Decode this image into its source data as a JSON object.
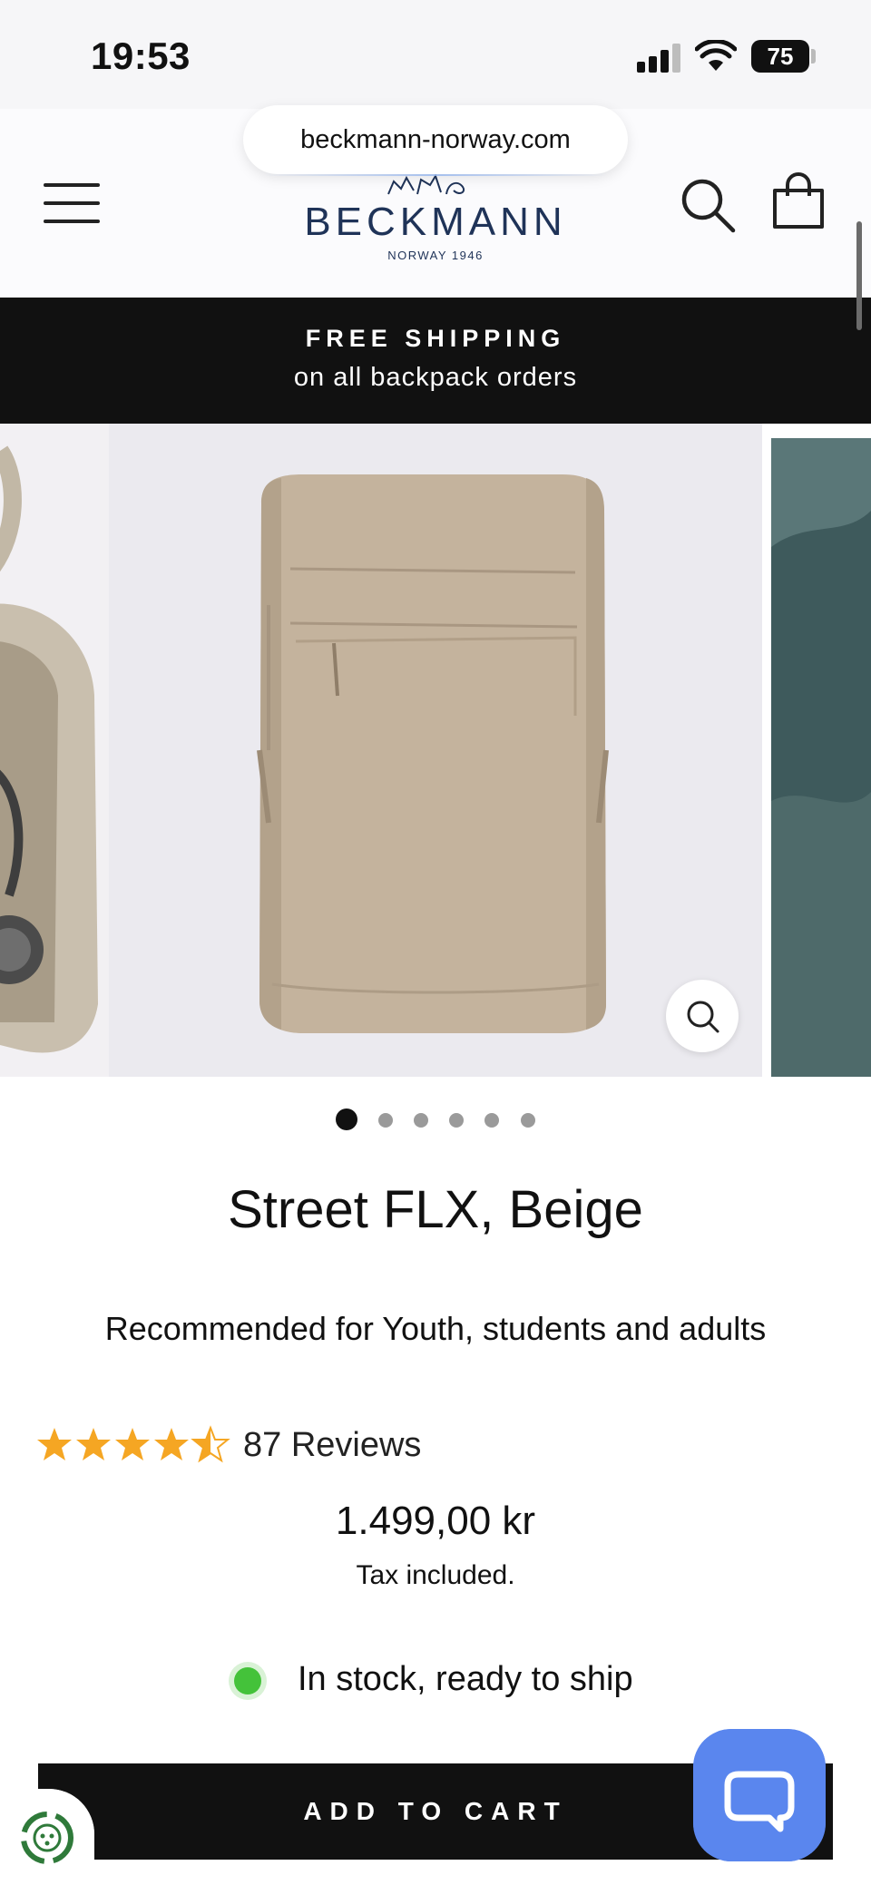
{
  "status_bar": {
    "time": "19:53",
    "battery": "75"
  },
  "browser": {
    "url": "beckmann-norway.com"
  },
  "header": {
    "logo_text": "BECKMANN",
    "logo_subtext": "NORWAY 1946"
  },
  "banner": {
    "title": "FREE SHIPPING",
    "subtitle": "on all backpack orders"
  },
  "carousel": {
    "slide_count": 6,
    "active_index": 0
  },
  "product": {
    "title": "Street FLX, Beige",
    "recommended": "Recommended for Youth, students and adults",
    "rating": 4.5,
    "reviews": "87 Reviews",
    "price": "1.499,00 kr",
    "tax_note": "Tax included.",
    "stock_status": "In stock, ready to ship",
    "add_to_cart_label": "ADD TO CART"
  },
  "colors": {
    "banner_bg": "#111111",
    "star": "#f5a623",
    "stock_green": "#44c23a",
    "chat_blue": "#5a86ee",
    "logo_navy": "#1f3358"
  }
}
